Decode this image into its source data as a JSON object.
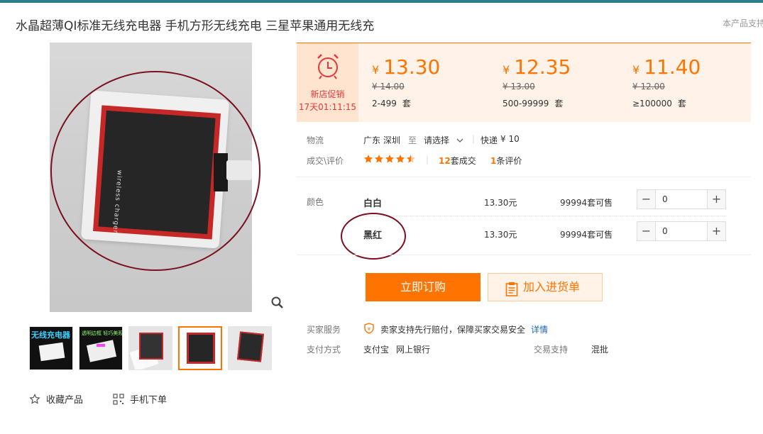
{
  "product": {
    "title": "水晶超薄QI标准无线充电器 手机方形无线充电 三星苹果通用无线充",
    "top_right_text": "本产品支持",
    "image_text": "wireless charger"
  },
  "thumbnails": [
    {
      "label": "无线充电器"
    },
    {
      "label": "透明边框 轻巧美观"
    },
    {
      "label": ""
    },
    {
      "label": ""
    },
    {
      "label": ""
    }
  ],
  "actions": {
    "favorite": "收藏产品",
    "mobile_order": "手机下单"
  },
  "promo": {
    "label": "新店促销",
    "timer": "17天01:11:15"
  },
  "price_tiers": [
    {
      "currency": "¥",
      "price": "13.30",
      "original": "¥ 14.00",
      "range": "2-499",
      "unit": "套"
    },
    {
      "currency": "¥",
      "price": "12.35",
      "original": "¥ 13.00",
      "range": "500-99999",
      "unit": "套"
    },
    {
      "currency": "¥",
      "price": "11.40",
      "original": "¥ 12.00",
      "range": "≥100000",
      "unit": "套"
    }
  ],
  "logistics": {
    "label": "物流",
    "origin": "广东 深圳",
    "to": "至",
    "destination": "请选择",
    "method": "快递",
    "fee": "¥ 10"
  },
  "deal": {
    "label": "成交\\评价",
    "rating": 4.5,
    "sold_count": "12",
    "sold_label": "套成交",
    "review_count": "1",
    "review_label": "条评价"
  },
  "specs": {
    "label": "颜色",
    "rows": [
      {
        "name": "白白",
        "price": "13.30元",
        "stock": "99994套可售",
        "qty": "0"
      },
      {
        "name": "黑红",
        "price": "13.30元",
        "stock": "99994套可售",
        "qty": "0"
      }
    ]
  },
  "buttons": {
    "buy": "立即订购",
    "add_to_list": "加入进货单"
  },
  "service": {
    "label": "买家服务",
    "text": "卖家支持先行赔付，保障买家交易安全",
    "link": "详情"
  },
  "payment": {
    "label": "支付方式",
    "methods": [
      "支付宝",
      "网上银行"
    ],
    "trade_label": "交易支持",
    "trade_value": "混批"
  },
  "colors": {
    "accent": "#ff7300",
    "promo_red": "#e4393c",
    "annotation": "#7a1020"
  }
}
